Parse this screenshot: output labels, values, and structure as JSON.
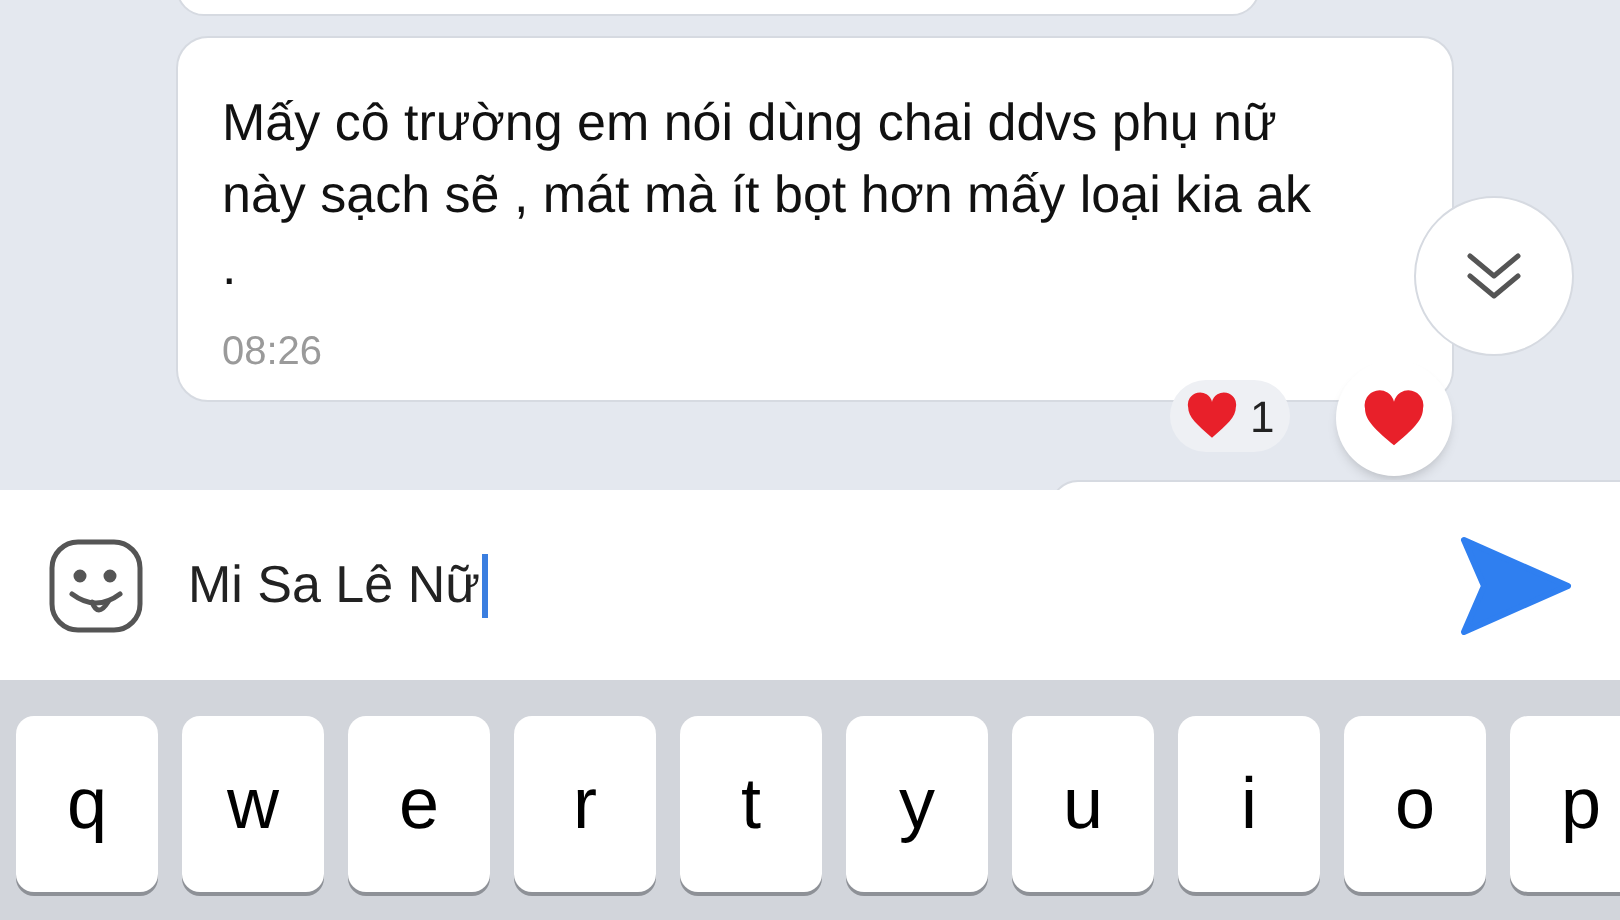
{
  "message": {
    "text": "Mấy cô trường em nói dùng chai ddvs phụ nữ này sạch sẽ , mát mà ít bọt hơn mấy loại kia ak .",
    "time": "08:26"
  },
  "reaction": {
    "count": "1"
  },
  "composer": {
    "value": "Mi Sa Lê Nữ"
  },
  "keyboard": {
    "keys": [
      "q",
      "w",
      "e",
      "r",
      "t",
      "y",
      "u",
      "i",
      "o",
      "p"
    ]
  }
}
